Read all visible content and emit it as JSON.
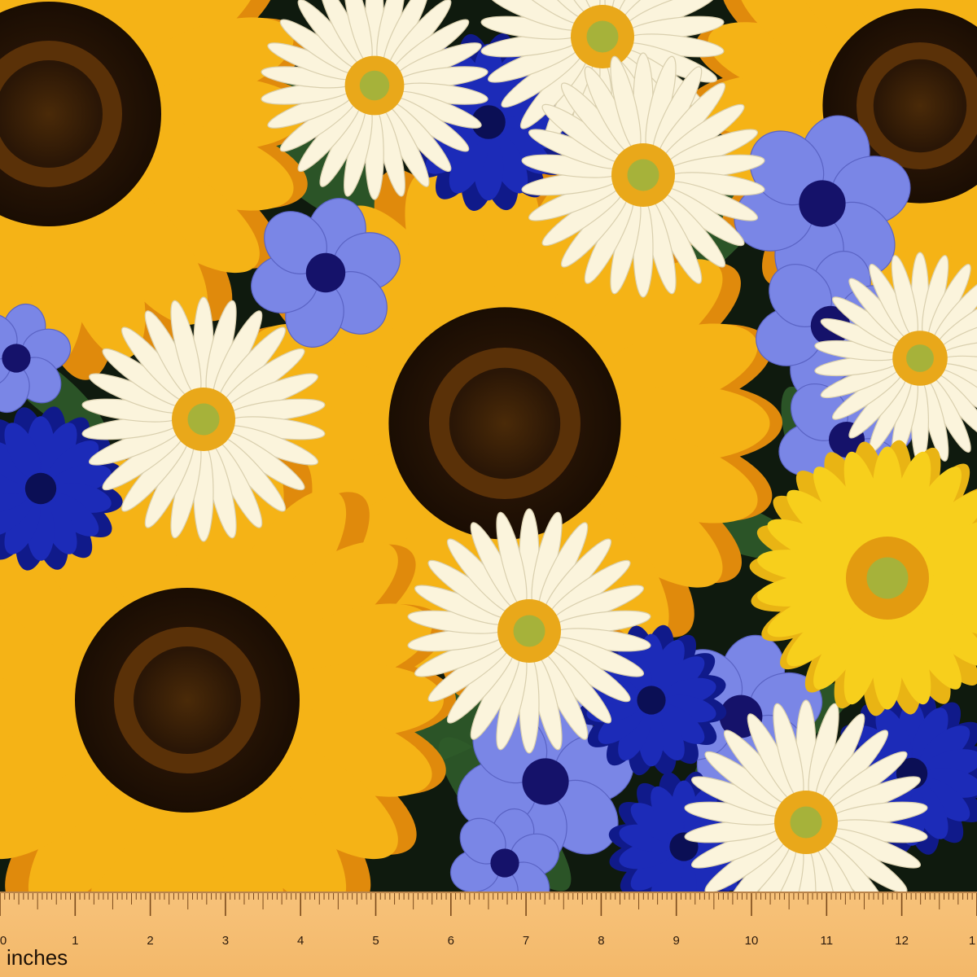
{
  "image": {
    "subject": "painted floral fabric print",
    "colors": {
      "background": "#0f1a0e",
      "leaf": "#2f5b2a",
      "sunflower_petal": "#f5b316",
      "sunflower_petal_dark": "#e08a0c",
      "sunflower_center": "#2a1606",
      "sunflower_center_ring": "#5a3108",
      "daisy_petal": "#fbf4dc",
      "daisy_center": "#e9a81a",
      "daisy_eye": "#a6b23a",
      "cornflower_blue": "#1c2bb8",
      "periwinkle": "#7a86e6",
      "periwinkle_center": "#15126a",
      "gerbera_yellow": "#f7cf1c"
    }
  },
  "ruler": {
    "unit_label": "inches",
    "numbers": [
      "0",
      "1",
      "2",
      "3",
      "4",
      "5",
      "6",
      "7",
      "8",
      "9",
      "10",
      "11",
      "12",
      "1"
    ],
    "color": "#f5bf74"
  }
}
